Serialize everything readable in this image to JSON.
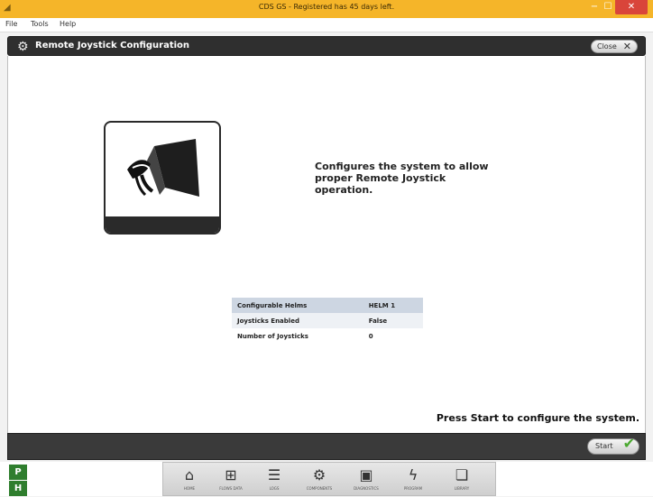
{
  "window": {
    "title": "CDS GS - Registered has 45 days left.",
    "minimize": "−",
    "maximize": "☐",
    "close": "✕"
  },
  "menu": [
    "File",
    "Tools",
    "Help"
  ],
  "header": {
    "title": "Remote Joystick Configuration",
    "close_label": "Close"
  },
  "main": {
    "description": "Configures the system to allow proper Remote Joystick operation.",
    "info": [
      {
        "label": "Configurable Helms",
        "value": "HELM 1"
      },
      {
        "label": "Joysticks Enabled",
        "value": "False"
      },
      {
        "label": "Number of Joysticks",
        "value": "0"
      }
    ],
    "prompt": "Press Start to configure the system."
  },
  "footer": {
    "start_label": "Start"
  },
  "side": {
    "p": "P",
    "h": "H"
  },
  "nav": [
    {
      "icon": "home-icon",
      "glyph": "⌂",
      "label": "HOME"
    },
    {
      "icon": "flow-icon",
      "glyph": "⊞",
      "label": "FLOWS DATA"
    },
    {
      "icon": "logs-icon",
      "glyph": "☰",
      "label": "LOGS"
    },
    {
      "icon": "components-icon",
      "glyph": "⚙",
      "label": "COMPONENTS"
    },
    {
      "icon": "diagnostics-icon",
      "glyph": "▣",
      "label": "DIAGNOSTICS"
    },
    {
      "icon": "program-icon",
      "glyph": "ϟ",
      "label": "PROGRAM"
    },
    {
      "icon": "library-icon",
      "glyph": "❏",
      "label": "LIBRARY"
    }
  ]
}
